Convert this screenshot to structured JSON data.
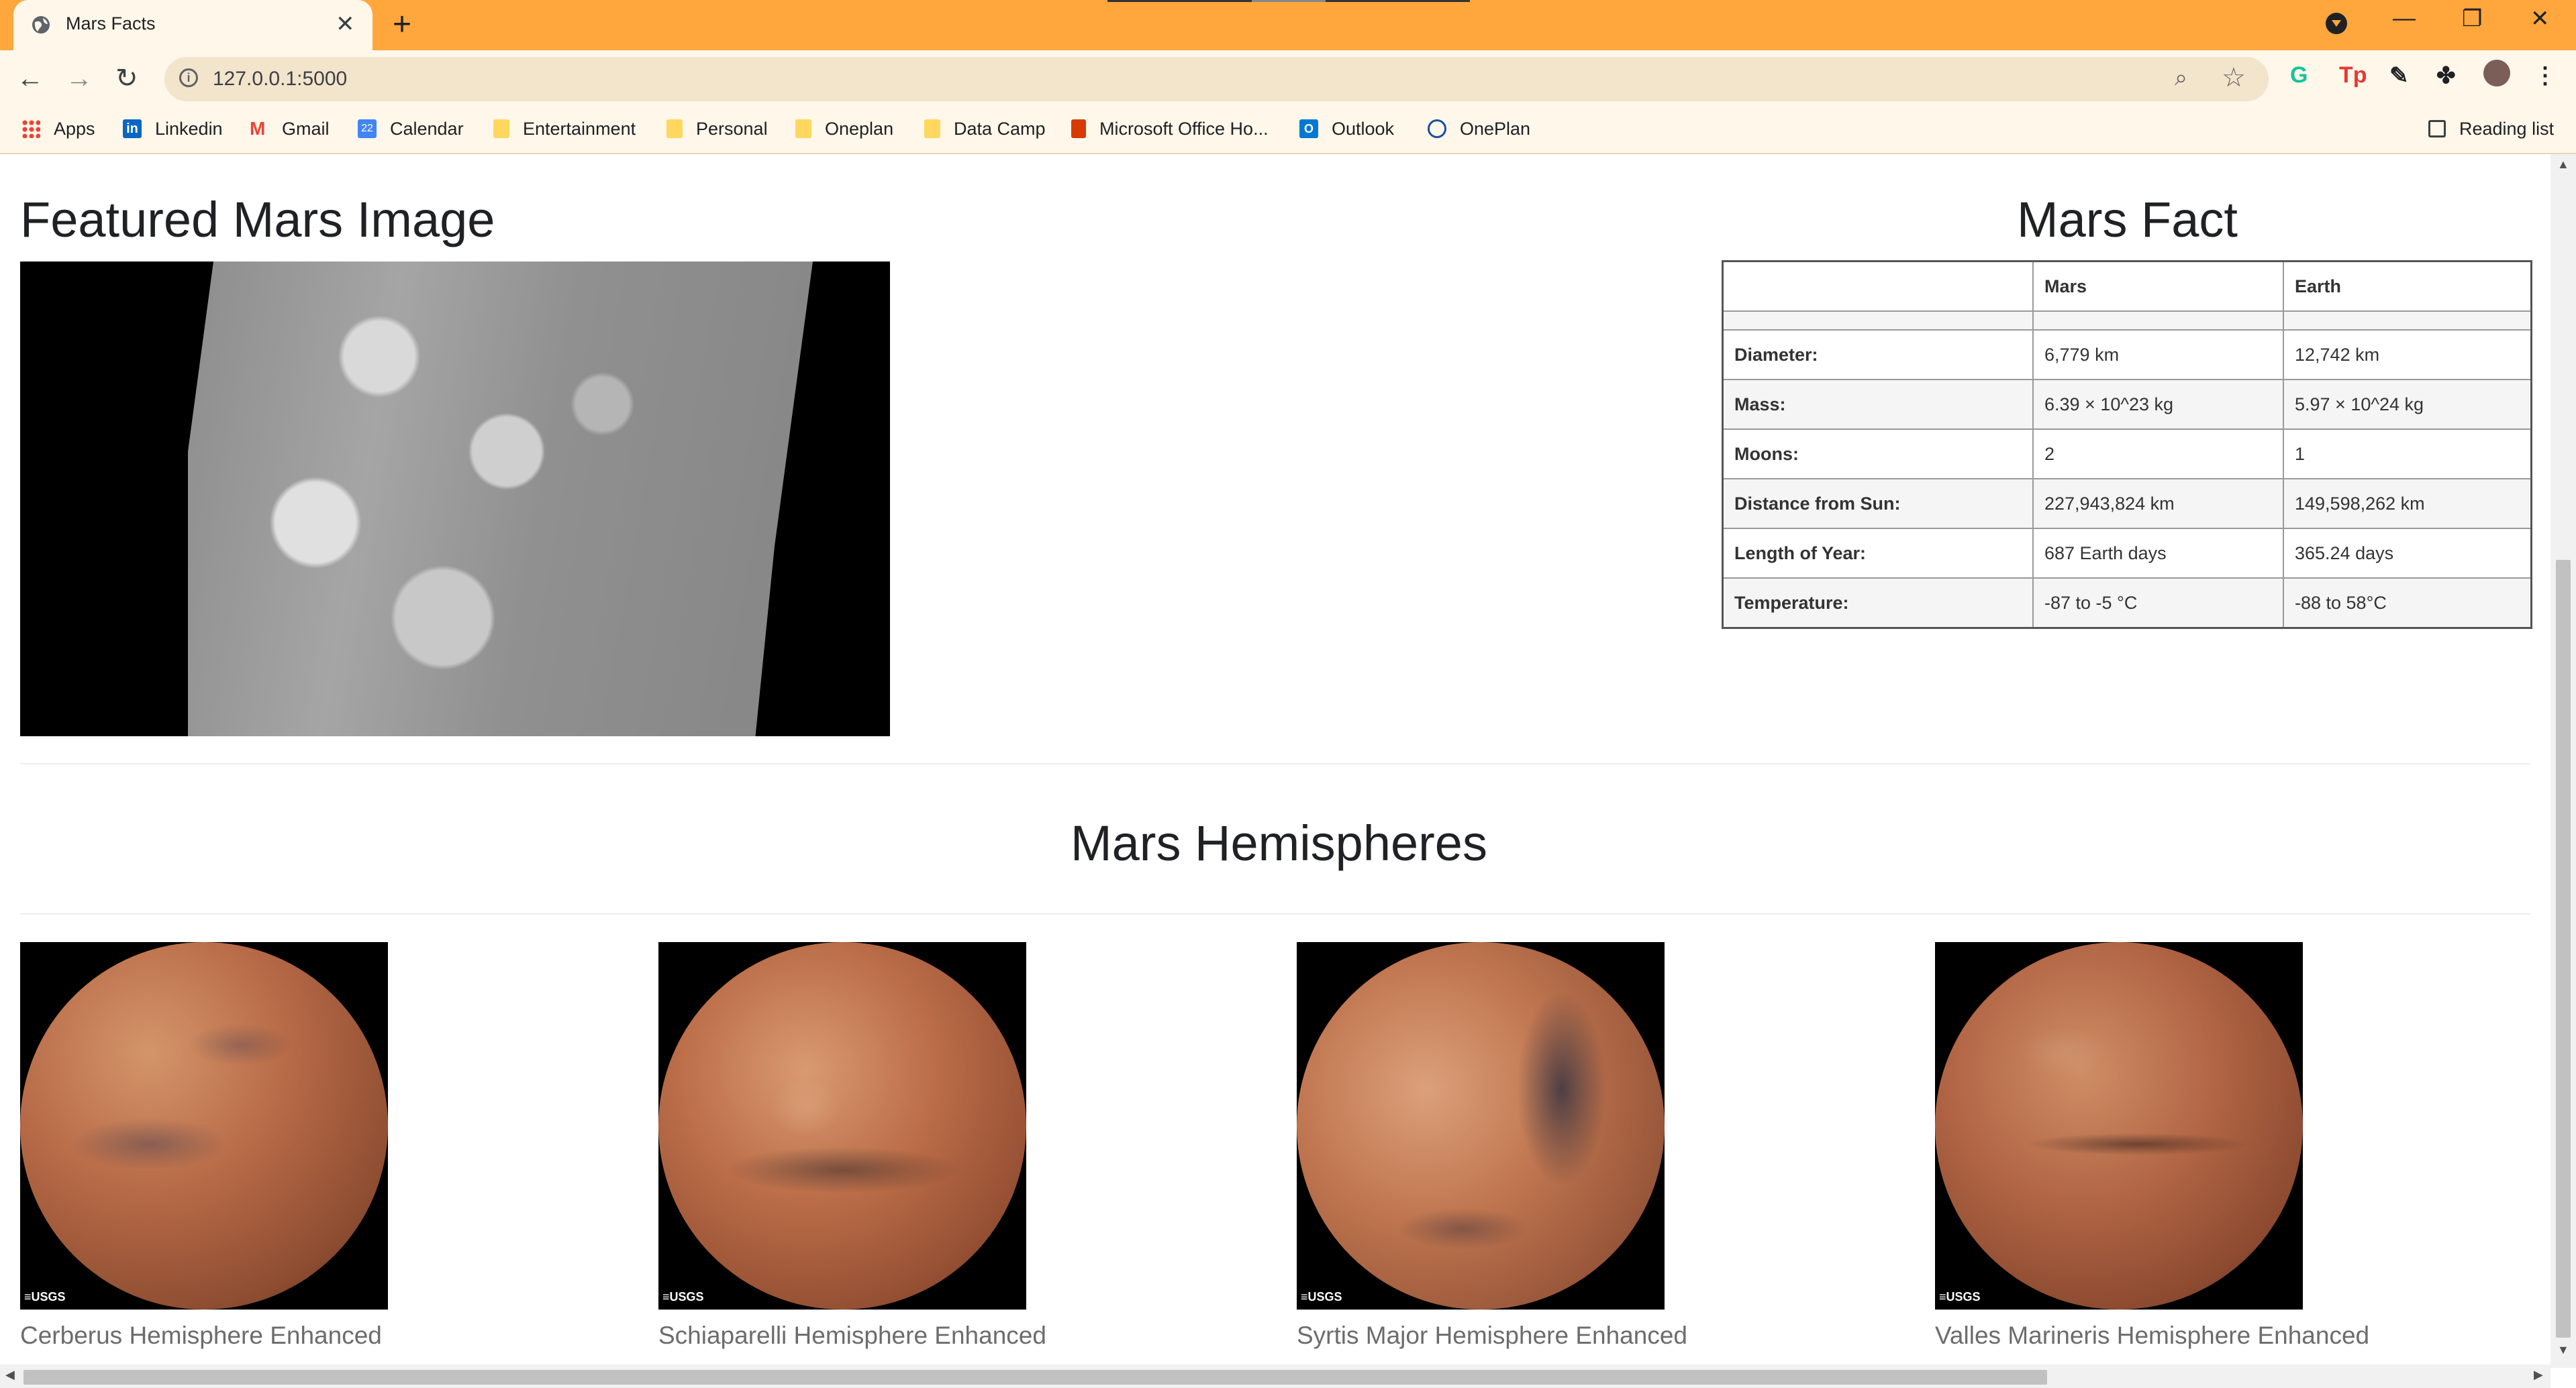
{
  "browser": {
    "tab_title": "Mars Facts",
    "url": "127.0.0.1:5000",
    "new_tab_symbol": "+",
    "close_tab_symbol": "✕",
    "bookmarks": [
      {
        "label": "Apps",
        "icon": "apps-grid-icon"
      },
      {
        "label": "Linkedin",
        "icon": "linkedin-icon"
      },
      {
        "label": "Gmail",
        "icon": "gmail-icon"
      },
      {
        "label": "Calendar",
        "icon": "calendar-icon"
      },
      {
        "label": "Entertainment",
        "icon": "folder-icon"
      },
      {
        "label": "Personal",
        "icon": "folder-icon"
      },
      {
        "label": "Oneplan",
        "icon": "folder-icon"
      },
      {
        "label": "Data Camp",
        "icon": "folder-icon"
      },
      {
        "label": "Microsoft Office Ho...",
        "icon": "office-icon"
      },
      {
        "label": "Outlook",
        "icon": "outlook-icon"
      },
      {
        "label": "OnePlan",
        "icon": "oneplan-icon"
      }
    ],
    "reading_list": "Reading list",
    "tab_bar_color": "#ffa73d",
    "toolbar_color": "#fff7ea"
  },
  "page": {
    "featured_title": "Featured Mars Image",
    "facts_title": "Mars Fact",
    "hemispheres_title": "Mars Hemispheres",
    "facts": {
      "headers": [
        "",
        "Mars",
        "Earth"
      ],
      "rows": [
        {
          "label": "Diameter:",
          "mars": "6,779 km",
          "earth": "12,742 km"
        },
        {
          "label": "Mass:",
          "mars": "6.39 × 10^23 kg",
          "earth": "5.97 × 10^24 kg"
        },
        {
          "label": "Moons:",
          "mars": "2",
          "earth": "1"
        },
        {
          "label": "Distance from Sun:",
          "mars": "227,943,824 km",
          "earth": "149,598,262 km"
        },
        {
          "label": "Length of Year:",
          "mars": "687 Earth days",
          "earth": "365.24 days"
        },
        {
          "label": "Temperature:",
          "mars": "-87 to -5 °C",
          "earth": "-88 to 58°C"
        }
      ]
    },
    "hemispheres": [
      {
        "title": "Cerberus Hemisphere Enhanced",
        "logo": "≡USGS"
      },
      {
        "title": "Schiaparelli Hemisphere Enhanced",
        "logo": "≡USGS"
      },
      {
        "title": "Syrtis Major Hemisphere Enhanced",
        "logo": "≡USGS"
      },
      {
        "title": "Valles Marineris Hemisphere Enhanced",
        "logo": "≡USGS"
      }
    ]
  }
}
